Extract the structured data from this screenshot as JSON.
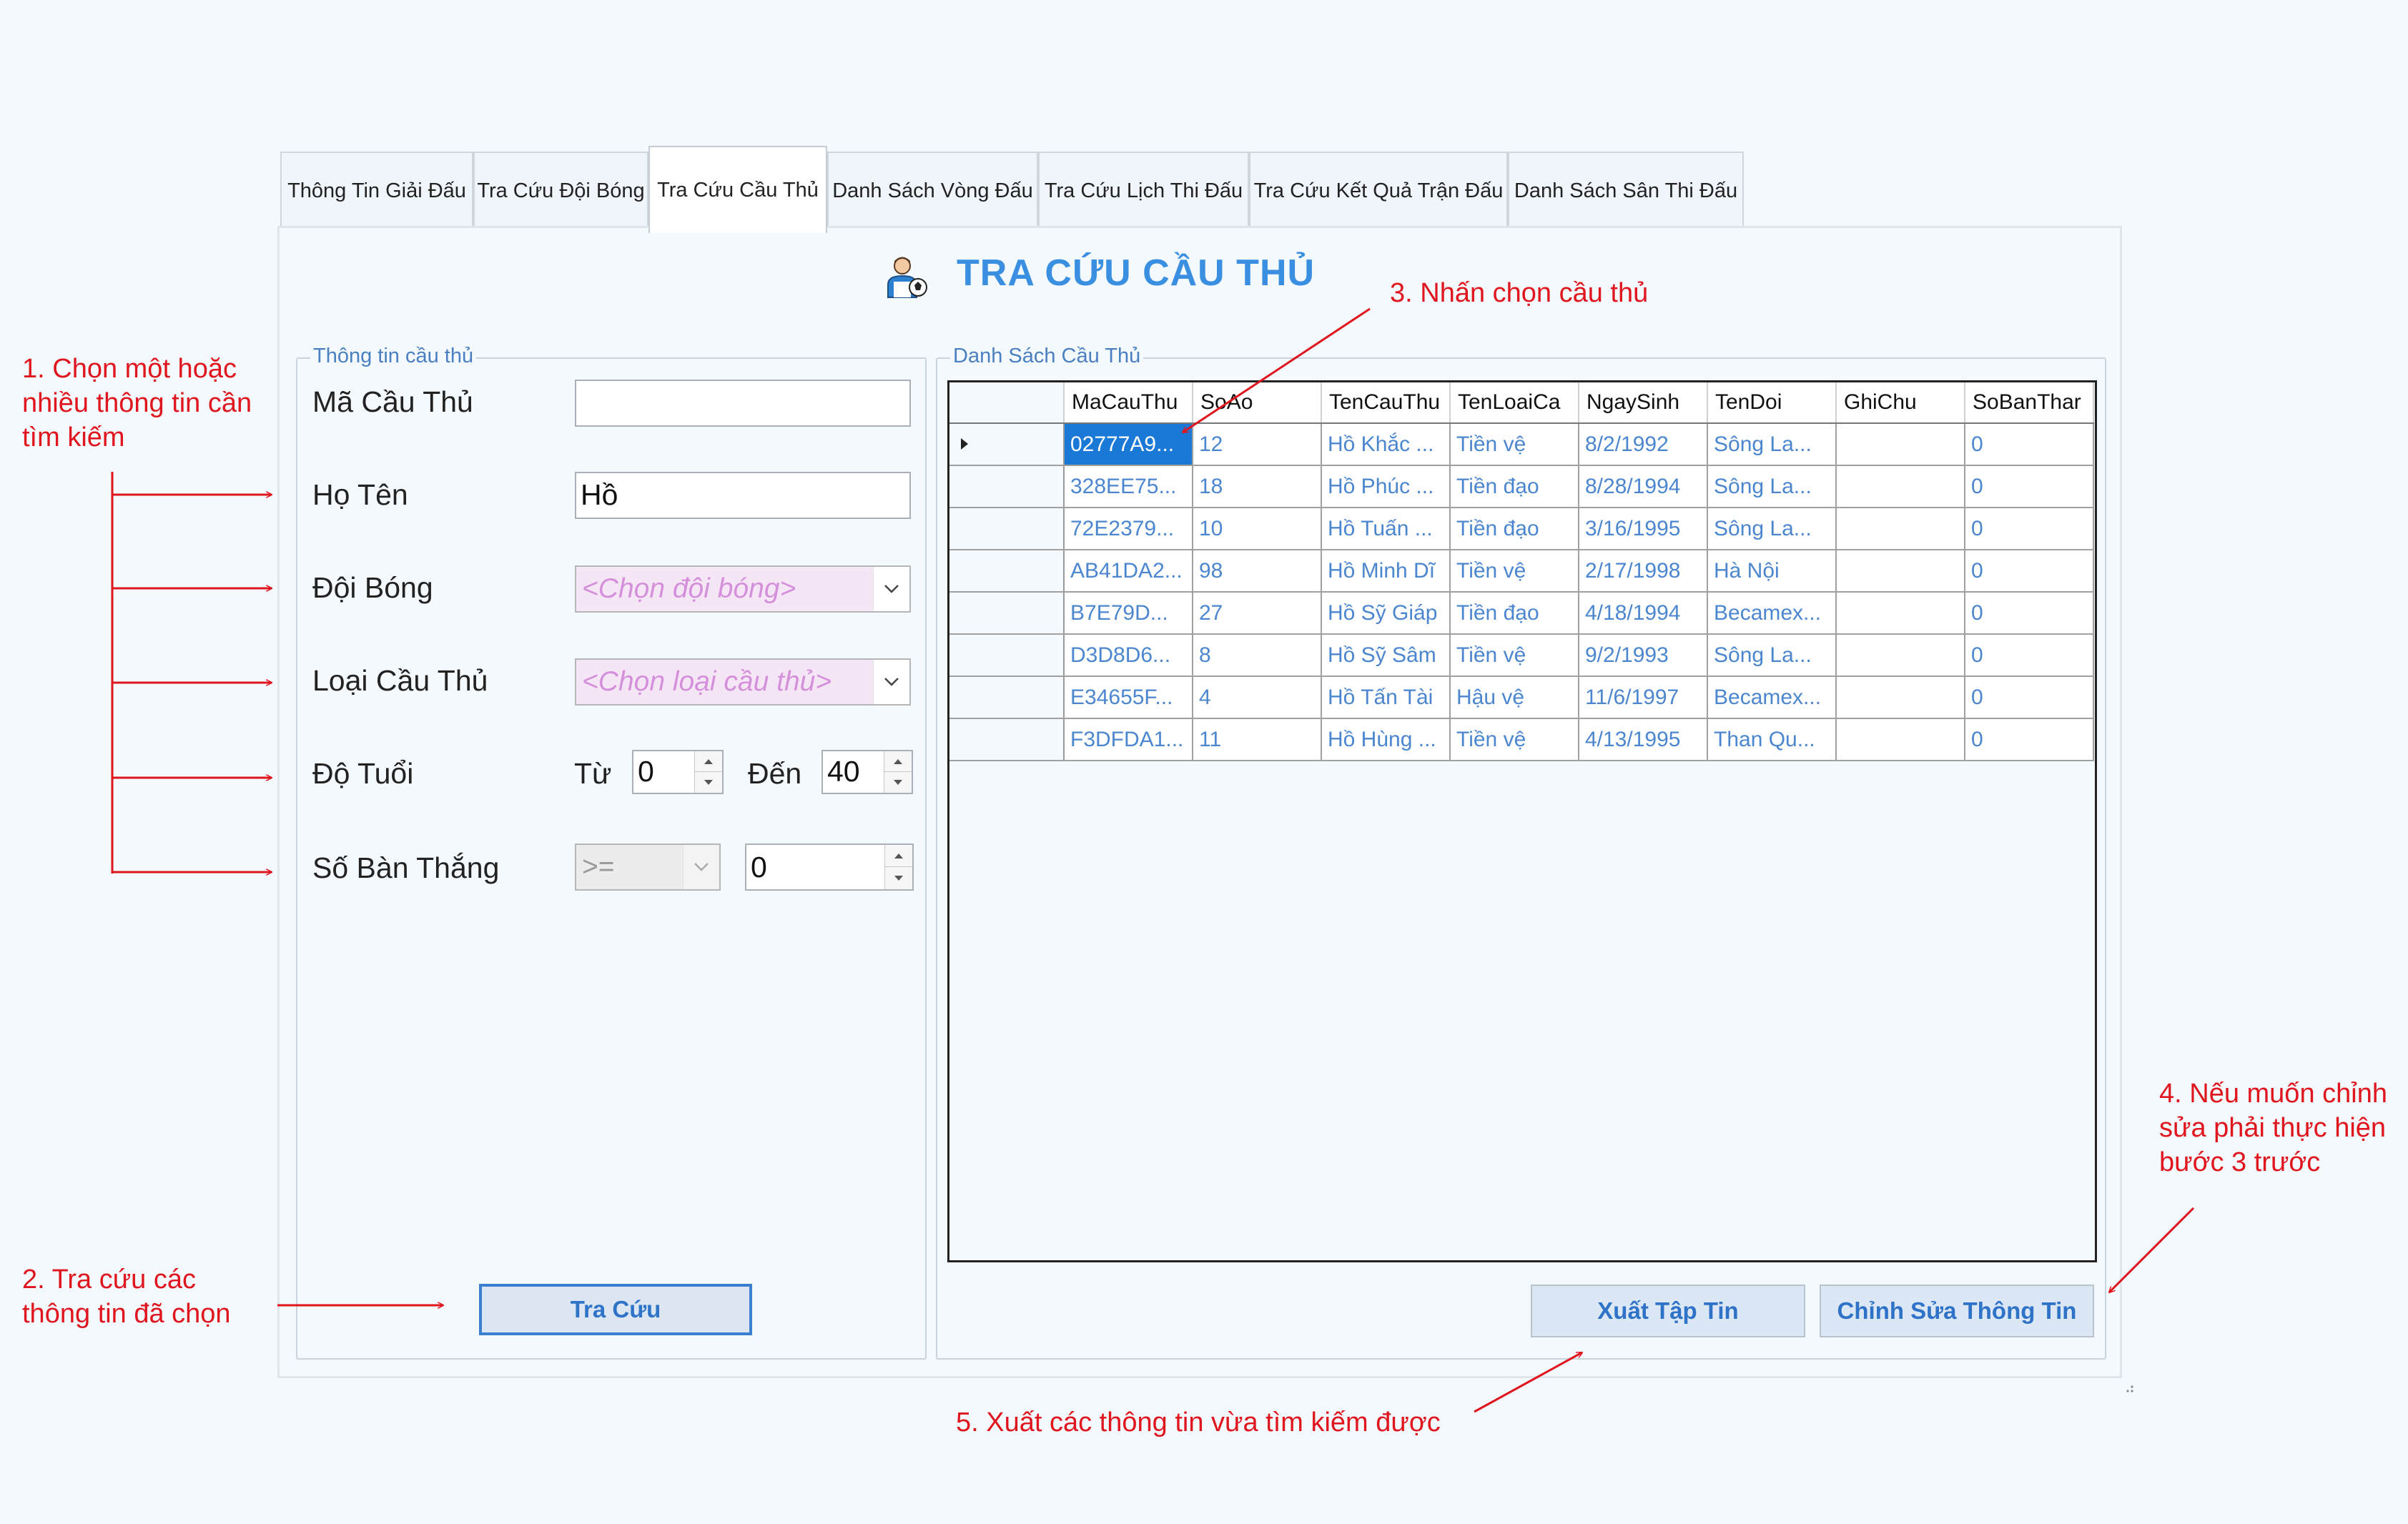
{
  "tabs": [
    "Thông Tin Giải Đấu",
    "Tra Cứu Đội Bóng",
    "Tra Cứu Cầu Thủ",
    "Danh Sách Vòng Đấu",
    "Tra Cứu Lịch Thi Đấu",
    "Tra Cứu Kết Quả Trận Đấu",
    "Danh Sách Sân Thi Đấu"
  ],
  "active_tab": "Tra Cứu Cầu Thủ",
  "page_title": "TRA CỨU CẦU THỦ",
  "player_icon": "player-icon",
  "search_group": {
    "legend": "Thông tin cầu thủ",
    "ma_label": "Mã Cầu Thủ",
    "ma_value": "",
    "ho_ten_label": "Họ Tên",
    "ho_ten_value": "Hồ",
    "doi_bong_label": "Đội Bóng",
    "doi_bong_placeholder": "<Chọn đội bóng>",
    "loai_label": "Loại Cầu Thủ",
    "loai_placeholder": "<Chọn loại cầu thủ>",
    "tuoi_label": "Độ Tuổi",
    "tu_label": "Từ",
    "tu_value": "0",
    "den_label": "Đến",
    "den_value": "40",
    "ban_thang_label": "Số Bàn Thắng",
    "ban_thang_op": ">=",
    "ban_thang_value": "0",
    "search_button": "Tra Cứu"
  },
  "list_group": {
    "legend": "Danh Sách Cầu Thủ",
    "columns": [
      "MaCauThu",
      "SoAo",
      "TenCauThu",
      "TenLoaiCa",
      "NgaySinh",
      "TenDoi",
      "GhiChu",
      "SoBanThar"
    ],
    "rows": [
      [
        "02777A9...",
        "12",
        "Hồ Khắc ...",
        "Tiền vệ",
        "8/2/1992",
        "Sông La...",
        "",
        "0"
      ],
      [
        "328EE75...",
        "18",
        "Hồ Phúc ...",
        "Tiền đạo",
        "8/28/1994",
        "Sông La...",
        "",
        "0"
      ],
      [
        "72E2379...",
        "10",
        "Hồ Tuấn ...",
        "Tiền đạo",
        "3/16/1995",
        "Sông La...",
        "",
        "0"
      ],
      [
        "AB41DA2...",
        "98",
        "Hồ Minh Dĩ",
        "Tiền vệ",
        "2/17/1998",
        "Hà Nội",
        "",
        "0"
      ],
      [
        "B7E79D...",
        "27",
        "Hồ Sỹ Giáp",
        "Tiền đạo",
        "4/18/1994",
        "Becamex...",
        "",
        "0"
      ],
      [
        "D3D8D6...",
        "8",
        "Hồ Sỹ Sâm",
        "Tiền vệ",
        "9/2/1993",
        "Sông La...",
        "",
        "0"
      ],
      [
        "E34655F...",
        "4",
        "Hồ Tấn Tài",
        "Hậu vệ",
        "11/6/1997",
        "Becamex...",
        "",
        "0"
      ],
      [
        "F3DFDA1...",
        "11",
        "Hồ Hùng ...",
        "Tiền vệ",
        "4/13/1995",
        "Than Qu...",
        "",
        "0"
      ]
    ],
    "export_button": "Xuất Tập Tin",
    "edit_button": "Chỉnh Sửa Thông Tin"
  },
  "annotations": {
    "a1_line1": "1. Chọn một hoặc",
    "a1_line2": "nhiều thông tin cần",
    "a1_line3": "tìm kiếm",
    "a2_line1": "2. Tra cứu các",
    "a2_line2": "thông tin đã chọn",
    "a3": "3. Nhấn chọn cầu thủ",
    "a4_line1": "4. Nếu muốn chỉnh",
    "a4_line2": "sửa phải thực hiện",
    "a4_line3": "bước 3 trước",
    "a5": "5. Xuất các thông tin vừa tìm kiếm được"
  },
  "colors": {
    "accent": "#3a8fe0",
    "annotation": "#e0161f",
    "selection": "#1a78d6",
    "combo_placeholder": "#d590dc"
  }
}
